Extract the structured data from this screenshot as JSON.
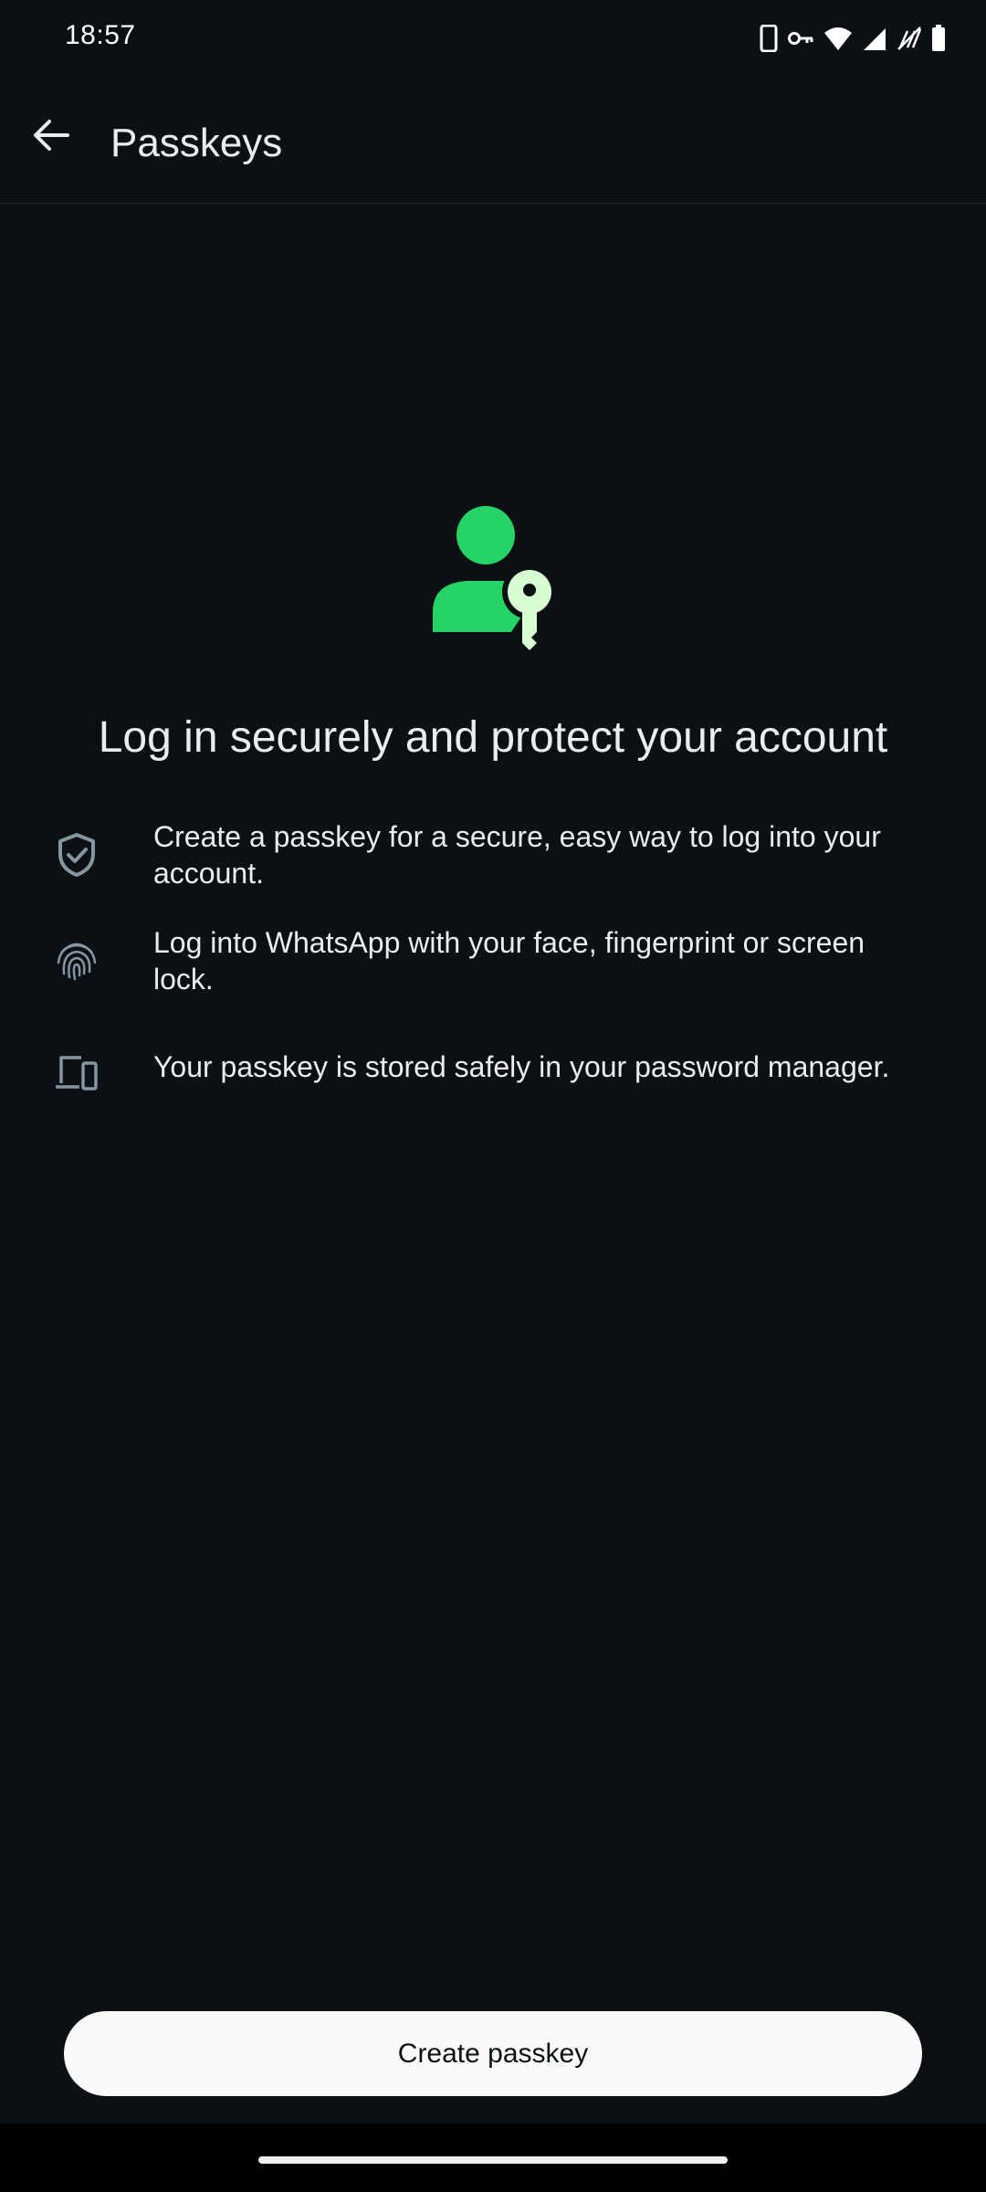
{
  "status_bar": {
    "time": "18:57",
    "icons": [
      "phone-device-icon",
      "vpn-key-icon",
      "wifi-icon",
      "cell-signal-icon",
      "no-data-icon",
      "battery-icon"
    ]
  },
  "app_bar": {
    "title": "Passkeys",
    "back_icon": "arrow-back-icon"
  },
  "hero": {
    "icon": "person-key-icon",
    "accent_color": "#25d366",
    "key_color": "#d9fdd3"
  },
  "headline": "Log in securely and protect your account",
  "features": [
    {
      "icon": "shield-check-icon",
      "text": "Create a passkey for a secure, easy way to log into your account."
    },
    {
      "icon": "fingerprint-icon",
      "text": "Log into WhatsApp with your face, fingerprint or screen lock."
    },
    {
      "icon": "devices-icon",
      "text": "Your passkey is stored safely in your password manager."
    }
  ],
  "create_button": {
    "label": "Create passkey"
  }
}
